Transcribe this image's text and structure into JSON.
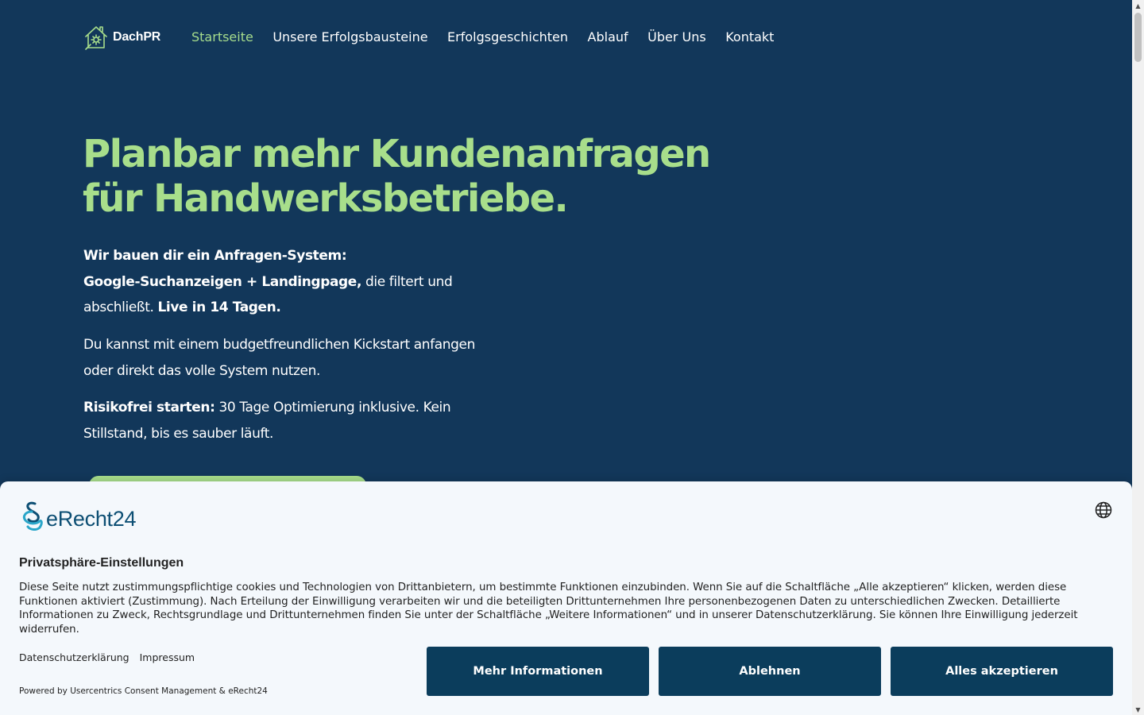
{
  "header": {
    "logo_text": "DachPR",
    "nav": [
      {
        "label": "Startseite"
      },
      {
        "label": "Unsere Erfolgsbausteine"
      },
      {
        "label": "Erfolgsgeschichten"
      },
      {
        "label": "Ablauf"
      },
      {
        "label": "Über Uns"
      },
      {
        "label": "Kontakt"
      }
    ]
  },
  "hero": {
    "title_line1": "Planbar mehr Kundenanfragen",
    "title_line2": "für Handwerksbetriebe.",
    "p1": {
      "strong1": "Wir bauen dir ein Anfragen-System:",
      "strong2": "Google-Suchanzeigen + Landingpage,",
      "text1": " die filtert und abschließt. ",
      "strong3": "Live in 14 Tagen."
    },
    "p2": "Du kannst mit einem budgetfreundlichen Kickstart anfangen oder direkt das volle System nutzen.",
    "p3": {
      "strong": "Risikofrei starten:",
      "text": " 30 Tage Optimierung inklusive. Kein Stillstand, bis es sauber läuft."
    }
  },
  "consent": {
    "brand": "eRecht24",
    "title": "Privatsphäre-Einstellungen",
    "text": "Diese Seite nutzt zustimmungspflichtige cookies und Technologien von Drittanbietern, um bestimmte Funktionen einzubinden. Wenn Sie auf die Schaltfläche „Alle akzeptieren“ klicken, werden diese Funktionen aktiviert (Zustimmung). Nach Erteilung der Einwilligung verarbeiten wir und die beteiligten Drittunternehmen Ihre personenbezogenen Daten zu unterschiedlichen Zwecken. Detaillierte Informationen zu Zweck, Rechtsgrundlage und Drittunternehmen finden Sie unter der Schaltfläche „Weitere Informationen“ und in unserer Datenschutzerklärung. Sie können Ihre Einwilligung jederzeit widerrufen.",
    "link_privacy": "Datenschutzerklärung",
    "link_imprint": "Impressum",
    "powered_by": "Powered by Usercentrics Consent Management & eRecht24",
    "btn_more": "Mehr Informationen",
    "btn_reject": "Ablehnen",
    "btn_accept": "Alles akzeptieren"
  },
  "colors": {
    "background": "#12375a",
    "accent": "#a8de8b",
    "consent_bg": "#f4f8fc",
    "button": "#0b3d5c"
  },
  "icons": {
    "logo": "house-icon",
    "consent_brand": "paragraph-icon",
    "language": "globe-icon"
  }
}
